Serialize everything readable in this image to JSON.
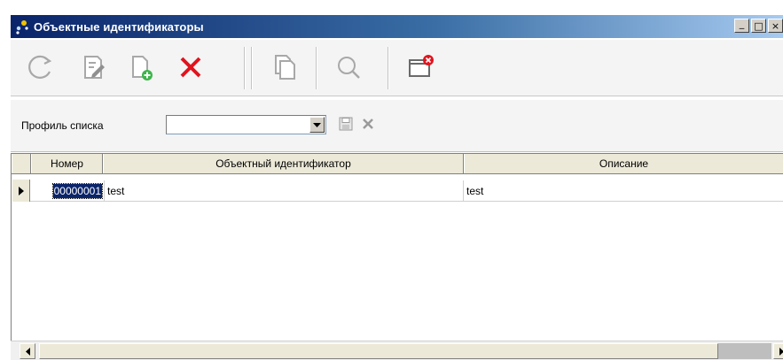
{
  "window": {
    "title": "Объектные идентификаторы",
    "controls": {
      "minimize": "_",
      "maximize": "□",
      "close": "×"
    }
  },
  "toolbar": {
    "buttons": [
      {
        "id": "refresh",
        "icon": "refresh-icon"
      },
      {
        "id": "edit",
        "icon": "edit-document-icon"
      },
      {
        "id": "add",
        "icon": "add-document-icon"
      },
      {
        "id": "delete",
        "icon": "delete-icon"
      },
      {
        "id": "copy",
        "icon": "copy-icon"
      },
      {
        "id": "search",
        "icon": "search-icon"
      },
      {
        "id": "close",
        "icon": "close-window-icon"
      }
    ],
    "colors": {
      "icon_gray": "#a8a8a8",
      "delete_red": "#e0141e",
      "add_green": "#3db54a",
      "close_red": "#e0141e"
    }
  },
  "profile": {
    "label": "Профиль списка",
    "value": ""
  },
  "grid": {
    "columns": [
      "Номер",
      "Объектный идентификатор",
      "Описание"
    ],
    "rows": [
      {
        "number": "00000001",
        "identifier": "test",
        "description": "test",
        "selected": true
      }
    ]
  }
}
